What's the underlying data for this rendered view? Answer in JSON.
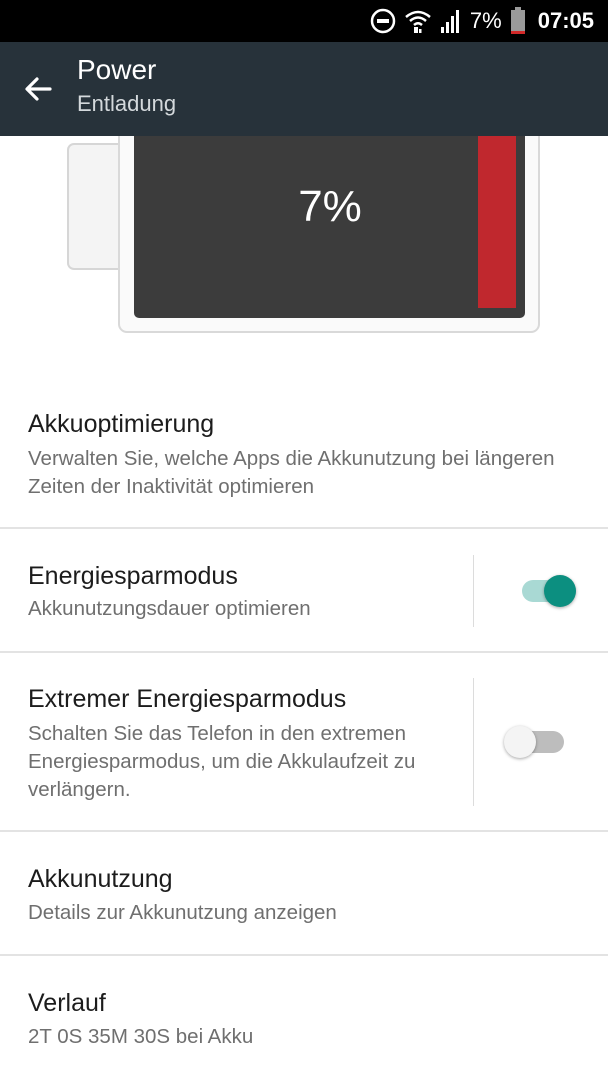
{
  "status_bar": {
    "battery_percent": "7%",
    "time": "07:05",
    "icons": [
      "do-not-disturb-icon",
      "wifi-icon",
      "cellular-signal-icon",
      "battery-icon"
    ]
  },
  "app_bar": {
    "back_icon": "arrow-back-icon",
    "title": "Power",
    "subtitle": "Entladung"
  },
  "battery": {
    "level_text": "7%",
    "level_fraction": 0.07,
    "fill_color": "#c0282e"
  },
  "items": [
    {
      "title": "Akkuoptimierung",
      "description": "Verwalten Sie, welche Apps die Akkunutzung bei längeren Zeiten der Inaktivität optimieren"
    },
    {
      "title": "Energiesparmodus",
      "description": "Akkunutzungsdauer optimieren",
      "toggle_on": true
    },
    {
      "title": "Extremer Energiesparmodus",
      "description": "Schalten Sie das Telefon in den extremen Energiesparmodus, um die Akkulaufzeit zu verlängern.",
      "toggle_on": false
    },
    {
      "title": "Akkunutzung",
      "description": "Details zur Akkunutzung anzeigen"
    },
    {
      "title": "Verlauf",
      "description": "2T 0S 35M 30S bei Akku"
    }
  ],
  "colors": {
    "app_bar": "#27323a",
    "accent": "#0c8f80",
    "battery_low": "#c0282e"
  }
}
